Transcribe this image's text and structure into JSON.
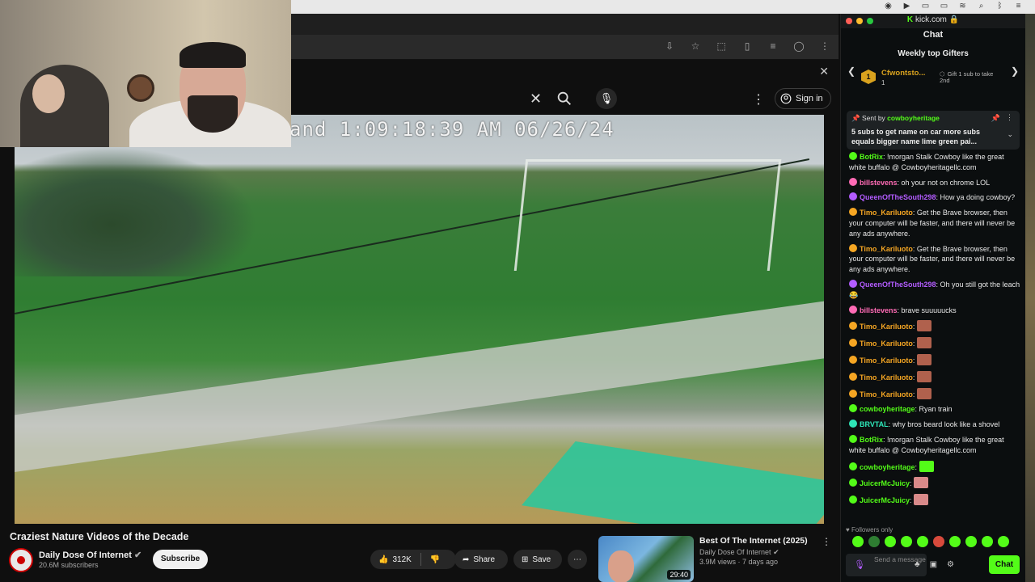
{
  "colors": {
    "kick_green": "#53fc18",
    "yt_bg": "#0f0f0f",
    "chat_bg": "#0b0e0f"
  },
  "youtube": {
    "header": {
      "signin_label": "Sign in"
    },
    "video": {
      "overlay_text": "and 1:09:18:39 AM 06/26/24",
      "title": "Craziest Nature Videos of the Decade",
      "channel": "Daily Dose Of Internet",
      "subscribers": "20.6M subscribers",
      "subscribe_label": "Subscribe",
      "likes": "312K",
      "share_label": "Share",
      "save_label": "Save"
    },
    "recommended": {
      "title": "Best Of The Internet (2025)",
      "channel": "Daily Dose Of Internet",
      "meta": "3.9M views · 7 days ago",
      "duration": "29:40"
    }
  },
  "chat": {
    "domain": "kick.com",
    "header": "Chat",
    "gifters": {
      "heading": "Weekly top Gifters",
      "top_name": "Cfwontsto...",
      "top_count": "1",
      "take_text": "Gift 1 sub to take 2nd"
    },
    "pinned": {
      "sent_by_label": "Sent by",
      "sent_by_user": "cowboyheritage",
      "message": "5 subs to get name on car more subs equals bigger name lime green pai..."
    },
    "messages": [
      {
        "user": "BotRix",
        "color": "#53fc18",
        "text": "!morgan Stalk Cowboy like the great white buffalo @ Cowboyheritagellc.com"
      },
      {
        "user": "billstevens",
        "color": "#ff6bb5",
        "text": "oh your not on chrome LOL"
      },
      {
        "user": "QueenOfTheSouth298",
        "color": "#b35cff",
        "text": "How ya doing cowboy?"
      },
      {
        "user": "Timo_Kariluoto",
        "color": "#f5a623",
        "text": "Get the Brave browser, then your computer will be faster, and there will never be any ads anywhere."
      },
      {
        "user": "Timo_Kariluoto",
        "color": "#f5a623",
        "text": "Get the Brave browser, then your computer will be faster, and there will never be any ads anywhere."
      },
      {
        "user": "QueenOfTheSouth298",
        "color": "#b35cff",
        "text": "Oh you still got the leach 😂"
      },
      {
        "user": "billstevens",
        "color": "#ff6bb5",
        "text": "brave suuuuucks"
      },
      {
        "user": "Timo_Kariluoto",
        "color": "#f5a623",
        "text": ""
      },
      {
        "user": "Timo_Kariluoto",
        "color": "#f5a623",
        "text": ""
      },
      {
        "user": "Timo_Kariluoto",
        "color": "#f5a623",
        "text": ""
      },
      {
        "user": "Timo_Kariluoto",
        "color": "#f5a623",
        "text": ""
      },
      {
        "user": "Timo_Kariluoto",
        "color": "#f5a623",
        "text": ""
      },
      {
        "user": "cowboyheritage",
        "color": "#53fc18",
        "text": "Ryan train"
      },
      {
        "user": "BRVTAL",
        "color": "#2ee6b8",
        "text": "why bros beard look like a shovel"
      },
      {
        "user": "BotRix",
        "color": "#53fc18",
        "text": "!morgan Stalk Cowboy like the great white buffalo @ Cowboyheritagellc.com"
      },
      {
        "user": "cowboyheritage",
        "color": "#53fc18",
        "text": ""
      },
      {
        "user": "JuicerMcJuicy",
        "color": "#53fc18",
        "text": ""
      },
      {
        "user": "JuicerMcJuicy",
        "color": "#53fc18",
        "text": ""
      }
    ],
    "followers_only": "Followers only",
    "input_placeholder": "Send a message",
    "send_label": "Chat"
  }
}
